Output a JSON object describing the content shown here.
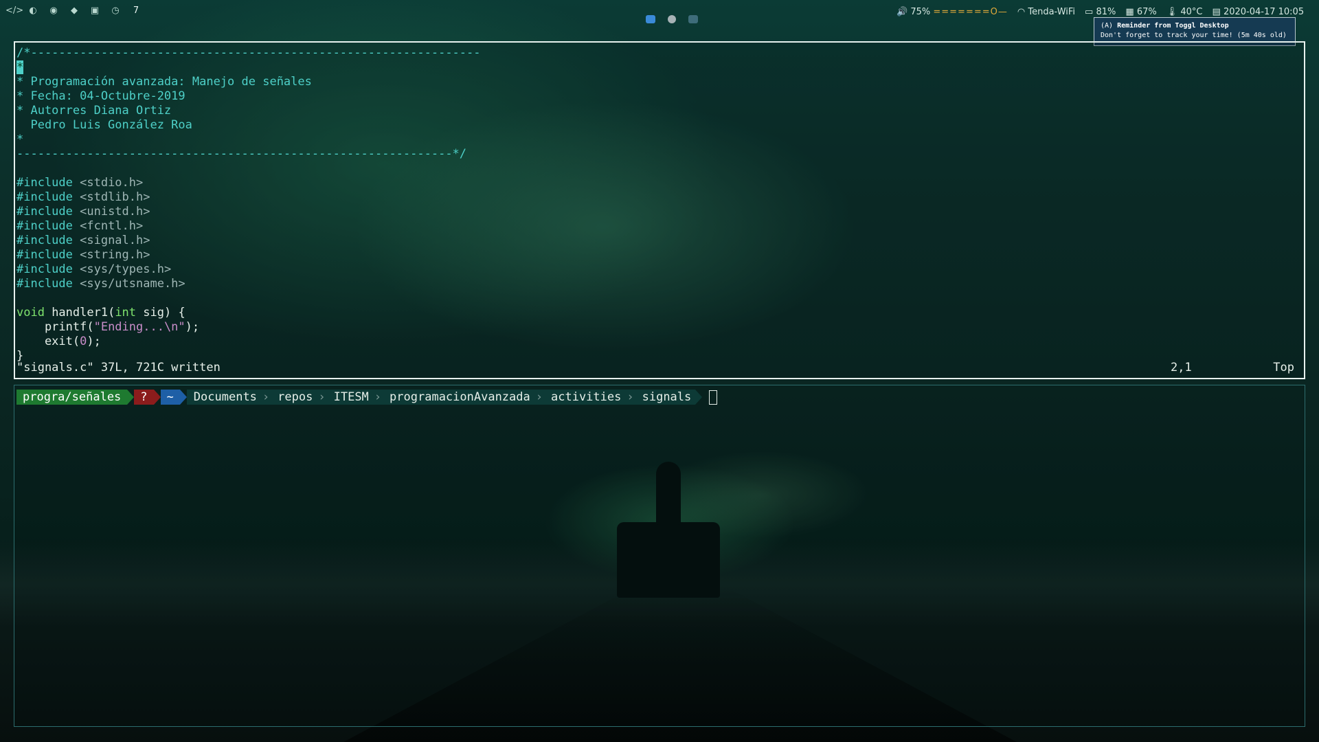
{
  "topbar": {
    "left_icons": [
      "code-icon",
      "globe-icon",
      "spotify-icon",
      "git-icon",
      "book-icon",
      "clock-icon"
    ],
    "workspace": "7",
    "tray_icons": [
      "zoom-icon",
      "steam-icon",
      "screenshot-icon"
    ],
    "volume": "75%",
    "volume_bar": "=======O—",
    "wifi": "Tenda-WiFi",
    "battery": "81%",
    "memory": "67%",
    "temp": "40°C",
    "datetime": "2020-04-17 10:05"
  },
  "notification": {
    "prefix": "(A)",
    "title": "Reminder from Toggl Desktop",
    "body": "Don't forget to track your time! (5m 40s old)"
  },
  "vim": {
    "lines": [
      {
        "parts": [
          {
            "cls": "cmt",
            "t": "/*----------------------------------------------------------------"
          }
        ]
      },
      {
        "parts": [
          {
            "cls": "cursor-block",
            "t": "*"
          }
        ]
      },
      {
        "parts": [
          {
            "cls": "cmt",
            "t": "* Programación avanzada: Manejo de señales"
          }
        ]
      },
      {
        "parts": [
          {
            "cls": "cmt",
            "t": "* Fecha: 04-Octubre-2019"
          }
        ]
      },
      {
        "parts": [
          {
            "cls": "cmt",
            "t": "* Autorres Diana Ortiz"
          }
        ]
      },
      {
        "parts": [
          {
            "cls": "cmt",
            "t": "  Pedro Luis González Roa"
          }
        ]
      },
      {
        "parts": [
          {
            "cls": "cmt",
            "t": "*"
          }
        ]
      },
      {
        "parts": [
          {
            "cls": "cmt",
            "t": "--------------------------------------------------------------*/"
          }
        ]
      },
      {
        "parts": [
          {
            "cls": "",
            "t": ""
          }
        ]
      },
      {
        "parts": [
          {
            "cls": "pre",
            "t": "#include "
          },
          {
            "cls": "inc",
            "t": "<stdio.h>"
          }
        ]
      },
      {
        "parts": [
          {
            "cls": "pre",
            "t": "#include "
          },
          {
            "cls": "inc",
            "t": "<stdlib.h>"
          }
        ]
      },
      {
        "parts": [
          {
            "cls": "pre",
            "t": "#include "
          },
          {
            "cls": "inc",
            "t": "<unistd.h>"
          }
        ]
      },
      {
        "parts": [
          {
            "cls": "pre",
            "t": "#include "
          },
          {
            "cls": "inc",
            "t": "<fcntl.h>"
          }
        ]
      },
      {
        "parts": [
          {
            "cls": "pre",
            "t": "#include "
          },
          {
            "cls": "inc",
            "t": "<signal.h>"
          }
        ]
      },
      {
        "parts": [
          {
            "cls": "pre",
            "t": "#include "
          },
          {
            "cls": "inc",
            "t": "<string.h>"
          }
        ]
      },
      {
        "parts": [
          {
            "cls": "pre",
            "t": "#include "
          },
          {
            "cls": "inc",
            "t": "<sys/types.h>"
          }
        ]
      },
      {
        "parts": [
          {
            "cls": "pre",
            "t": "#include "
          },
          {
            "cls": "inc",
            "t": "<sys/utsname.h>"
          }
        ]
      },
      {
        "parts": [
          {
            "cls": "",
            "t": ""
          }
        ]
      },
      {
        "parts": [
          {
            "cls": "kw",
            "t": "void"
          },
          {
            "cls": "",
            "t": " handler1("
          },
          {
            "cls": "kw",
            "t": "int"
          },
          {
            "cls": "",
            "t": " sig) {"
          }
        ]
      },
      {
        "parts": [
          {
            "cls": "",
            "t": "    printf("
          },
          {
            "cls": "str",
            "t": "\"Ending...\\n\""
          },
          {
            "cls": "",
            "t": ");"
          }
        ]
      },
      {
        "parts": [
          {
            "cls": "",
            "t": "    exit("
          },
          {
            "cls": "num",
            "t": "0"
          },
          {
            "cls": "",
            "t": ");"
          }
        ]
      },
      {
        "parts": [
          {
            "cls": "",
            "t": "}"
          }
        ]
      }
    ],
    "status_message": "\"signals.c\" 37L, 721C written",
    "cursor_pos": "2,1",
    "scroll": "Top"
  },
  "terminal": {
    "branch": "progra/señales",
    "status": "?",
    "home": "~",
    "path": [
      "Documents",
      "repos",
      "ITESM",
      "programacionAvanzada",
      "activities",
      "signals"
    ]
  }
}
